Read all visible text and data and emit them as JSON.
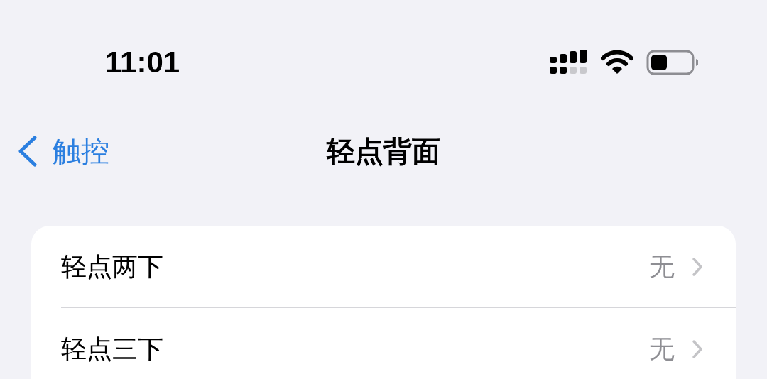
{
  "status_bar": {
    "time": "11:01"
  },
  "nav": {
    "back": "触控",
    "title": "轻点背面"
  },
  "rows": [
    {
      "label": "轻点两下",
      "value": "无"
    },
    {
      "label": "轻点三下",
      "value": "无"
    }
  ]
}
